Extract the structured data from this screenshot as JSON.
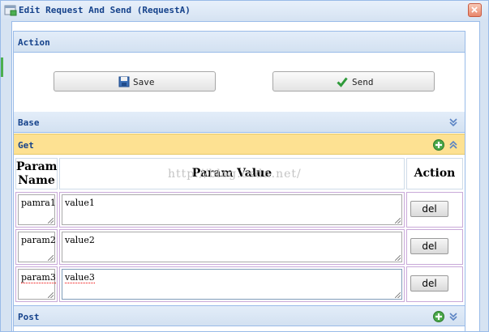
{
  "window": {
    "title": "Edit Request And Send (RequestA)"
  },
  "panels": {
    "action": {
      "title": "Action"
    },
    "base": {
      "title": "Base"
    },
    "get": {
      "title": "Get"
    },
    "post": {
      "title": "Post"
    }
  },
  "buttons": {
    "save": "Save",
    "send": "Send"
  },
  "table": {
    "headers": {
      "name": "Param Name",
      "value": "Param Value",
      "action": "Action"
    },
    "rows": [
      {
        "name": "pamra1",
        "value": "value1",
        "action": "del"
      },
      {
        "name": "param2",
        "value": "value2",
        "action": "del"
      },
      {
        "name": "param3",
        "value": "value3",
        "action": "del"
      }
    ]
  },
  "watermark": "http://blog.csdn.net/",
  "colors": {
    "header_blue": "#15428b",
    "get_header": "#fde192",
    "border_blue": "#99bbe8",
    "param_border": "#c9a9d9"
  },
  "icons": {
    "window": "window-icon",
    "close": "close-icon",
    "save": "floppy-disk-icon",
    "send": "checkmark-icon",
    "expand": "chevron-double-down-icon",
    "collapse": "chevron-double-up-icon",
    "add": "plus-icon"
  }
}
